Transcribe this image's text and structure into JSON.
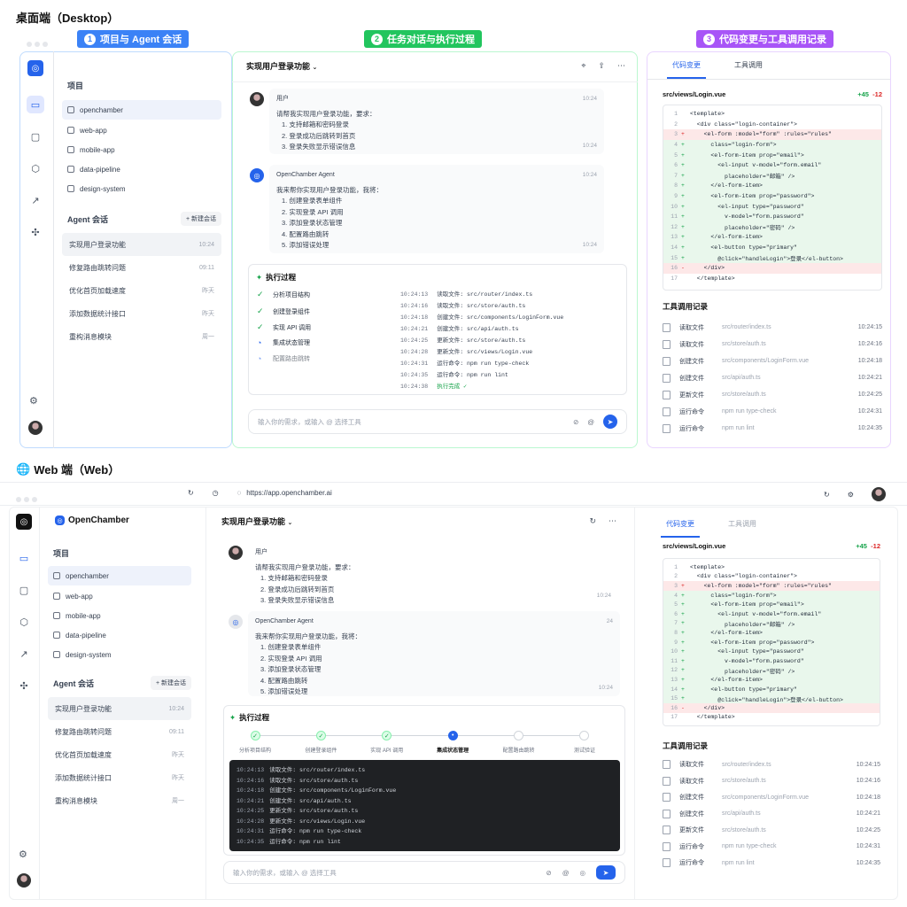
{
  "desktop": {
    "section_title": "桌面端（Desktop）",
    "tags": [
      {
        "num": "1",
        "label": "项目与 Agent 会话",
        "color": "#3b82f6"
      },
      {
        "num": "2",
        "label": "任务对话与执行过程",
        "color": "#22c55e"
      },
      {
        "num": "3",
        "label": "代码变更与工具调用记录",
        "color": "#a855f7"
      }
    ]
  },
  "web": {
    "section_title": "Web 端（Web）",
    "url": "https://app.openchamber.ai",
    "brand": "OpenChamber"
  },
  "sidebar": {
    "projects_title": "项目",
    "projects": [
      "openchamber",
      "web-app",
      "mobile-app",
      "data-pipeline",
      "design-system"
    ],
    "sessions_title": "Agent 会话",
    "new_session": "+ 新建会话",
    "sessions": [
      {
        "title": "实现用户登录功能",
        "time": "10:24"
      },
      {
        "title": "修复路由跳转问题",
        "time": "09:11"
      },
      {
        "title": "优化首页加载速度",
        "time": "昨天"
      },
      {
        "title": "添加数据统计接口",
        "time": "昨天"
      },
      {
        "title": "重构消息模块",
        "time": "周一"
      }
    ]
  },
  "chat": {
    "title": "实现用户登录功能",
    "user_name": "用户",
    "user_time": "10:24",
    "user_intro": "请帮我实现用户登录功能，要求：",
    "user_items": [
      "1. 支持邮箱和密码登录",
      "2. 登录成功后跳转到首页",
      "3. 登录失败显示错误信息"
    ],
    "user_time2": "10:24",
    "agent_name": "OpenChamber Agent",
    "agent_time": "10:24",
    "agent_time_web": "24",
    "agent_intro": "我来帮你实现用户登录功能，我将：",
    "agent_items": [
      "1. 创建登录表单组件",
      "2. 实现登录 API 调用",
      "3. 添加登录状态管理",
      "4. 配置路由跳转",
      "5. 添加错误处理"
    ],
    "agent_time2": "10:24",
    "exec_title": "执行过程",
    "steps": [
      "分析项目结构",
      "创建登录组件",
      "实现 API 调用",
      "集成状态管理",
      "配置路由跳转"
    ],
    "steps_web": [
      "分析项目结构",
      "创建登录组件",
      "实现 API 调用",
      "集成状态管理",
      "配置路由跳转",
      "测试验证"
    ],
    "logs": [
      {
        "time": "10:24:13",
        "text": "读取文件: src/router/index.ts"
      },
      {
        "time": "10:24:16",
        "text": "读取文件: src/store/auth.ts"
      },
      {
        "time": "10:24:18",
        "text": "创建文件: src/components/LoginForm.vue"
      },
      {
        "time": "10:24:21",
        "text": "创建文件: src/api/auth.ts"
      },
      {
        "time": "10:24:25",
        "text": "更新文件: src/store/auth.ts"
      },
      {
        "time": "10:24:28",
        "text": "更新文件: src/views/Login.vue"
      },
      {
        "time": "10:24:31",
        "text": "运行命令: npm run type-check"
      },
      {
        "time": "10:24:35",
        "text": "运行命令: npm run lint"
      },
      {
        "time": "10:24:38",
        "text": "执行完成 ✓"
      }
    ],
    "input_placeholder": "输入你的需求，或输入 @ 选择工具"
  },
  "right": {
    "tab_code": "代码变更",
    "tab_tools": "工具调用",
    "file": "src/views/Login.vue",
    "adds": "+45",
    "dels": "-12",
    "code": [
      {
        "n": "1",
        "m": "",
        "t": "<template>",
        "k": ""
      },
      {
        "n": "2",
        "m": "",
        "t": "  <div class=\"login-container\">",
        "k": ""
      },
      {
        "n": "3",
        "m": "+",
        "t": "    <el-form :model=\"form\" :rules=\"rules\"",
        "k": "d"
      },
      {
        "n": "4",
        "m": "+",
        "t": "      class=\"login-form\">",
        "k": "a"
      },
      {
        "n": "5",
        "m": "+",
        "t": "      <el-form-item prop=\"email\">",
        "k": "a"
      },
      {
        "n": "6",
        "m": "+",
        "t": "        <el-input v-model=\"form.email\"",
        "k": "a"
      },
      {
        "n": "7",
        "m": "+",
        "t": "          placeholder=\"邮箱\" />",
        "k": "a"
      },
      {
        "n": "8",
        "m": "+",
        "t": "      </el-form-item>",
        "k": "a"
      },
      {
        "n": "9",
        "m": "+",
        "t": "      <el-form-item prop=\"password\">",
        "k": "a"
      },
      {
        "n": "10",
        "m": "+",
        "t": "        <el-input type=\"password\"",
        "k": "a"
      },
      {
        "n": "11",
        "m": "+",
        "t": "          v-model=\"form.password\"",
        "k": "a"
      },
      {
        "n": "12",
        "m": "+",
        "t": "          placeholder=\"密码\" />",
        "k": "a"
      },
      {
        "n": "13",
        "m": "+",
        "t": "      </el-form-item>",
        "k": "a"
      },
      {
        "n": "14",
        "m": "+",
        "t": "      <el-button type=\"primary\"",
        "k": "a"
      },
      {
        "n": "15",
        "m": "+",
        "t": "        @click=\"handleLogin\">登录</el-button>",
        "k": "a"
      },
      {
        "n": "16",
        "m": "-",
        "t": "    </div>",
        "k": "d"
      },
      {
        "n": "17",
        "m": "",
        "t": "  </template>",
        "k": ""
      }
    ],
    "tools_title": "工具调用记录",
    "tools": [
      {
        "action": "读取文件",
        "path": "src/router/index.ts",
        "time": "10:24:15"
      },
      {
        "action": "读取文件",
        "path": "src/store/auth.ts",
        "time": "10:24:16"
      },
      {
        "action": "创建文件",
        "path": "src/components/LoginForm.vue",
        "time": "10:24:18"
      },
      {
        "action": "创建文件",
        "path": "src/api/auth.ts",
        "time": "10:24:21"
      },
      {
        "action": "更新文件",
        "path": "src/store/auth.ts",
        "time": "10:24:25"
      },
      {
        "action": "运行命令",
        "path": "npm run type-check",
        "time": "10:24:31"
      },
      {
        "action": "运行命令",
        "path": "npm run lint",
        "time": "10:24:35"
      }
    ]
  }
}
